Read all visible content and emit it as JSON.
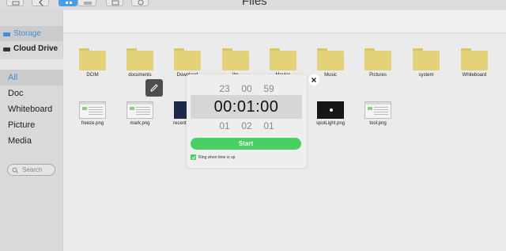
{
  "window": {
    "title": "Files"
  },
  "toolbar": {
    "buttons": [
      {
        "name": "window-button",
        "icon": "window-icon",
        "active": false
      },
      {
        "name": "back-button",
        "icon": "back-arrow-icon",
        "active": false
      },
      {
        "name": "grid-view-button",
        "icon": "grid-icon",
        "active": true
      },
      {
        "name": "list-view-button",
        "icon": "list-icon",
        "active": false
      },
      {
        "name": "copy-button",
        "icon": "copy-icon",
        "active": false
      },
      {
        "name": "delete-button",
        "icon": "trash-icon",
        "active": false
      }
    ]
  },
  "sidebar": {
    "storage_label": "Storage",
    "cloud_label": "Cloud Drive",
    "categories": [
      {
        "label": "All",
        "active": true
      },
      {
        "label": "Doc",
        "active": false
      },
      {
        "label": "Whiteboard",
        "active": false
      },
      {
        "label": "Picture",
        "active": false
      },
      {
        "label": "Media",
        "active": false
      }
    ],
    "search_placeholder": "Search"
  },
  "files": {
    "folders": [
      "DCIM",
      "documents",
      "Download",
      "lbs",
      "Movies",
      "Music",
      "Pictures",
      "system",
      "Whiteboard"
    ],
    "images": [
      "freeze.png",
      "mark.png",
      "recent.",
      "spotLight.png",
      "tool.png"
    ]
  },
  "timer": {
    "prev_row": [
      "23",
      "00",
      "59"
    ],
    "current": "00:01:00",
    "next_row": [
      "01",
      "02",
      "01"
    ],
    "start_label": "Start",
    "ring_label": "Ring when time is up",
    "ring_checked": true
  },
  "colors": {
    "accent": "#3d8fe0",
    "start_green": "#46d162",
    "folder": "#e3d277"
  }
}
